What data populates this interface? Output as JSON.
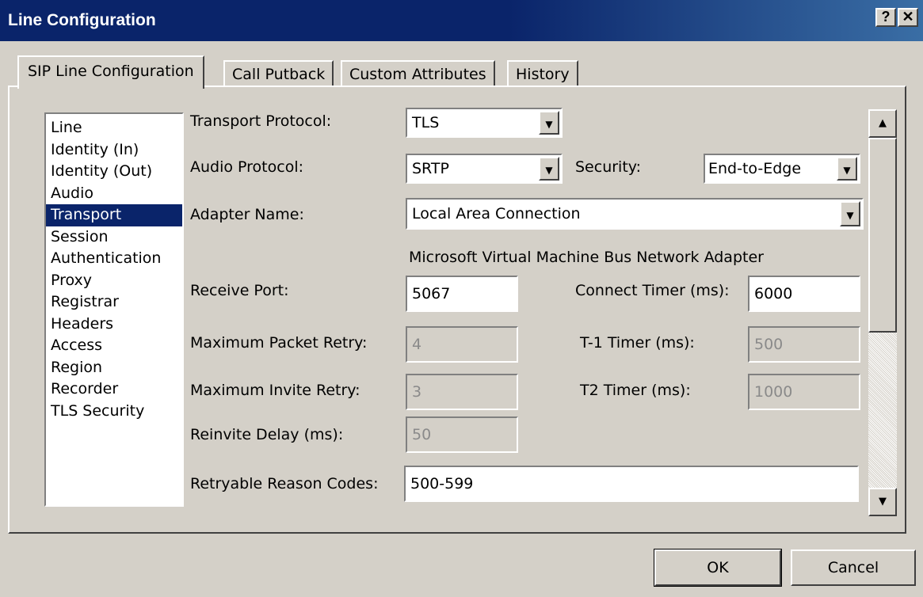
{
  "window": {
    "title": "Line Configuration",
    "help_label": "?",
    "close_label": "✕"
  },
  "tabs": [
    {
      "label": "SIP Line Configuration",
      "active": true
    },
    {
      "label": "Call Putback",
      "active": false
    },
    {
      "label": "Custom Attributes",
      "active": false
    },
    {
      "label": "History",
      "active": false
    }
  ],
  "nav_list": {
    "items": [
      "Line",
      "Identity (In)",
      "Identity (Out)",
      "Audio",
      "Transport",
      "Session",
      "Authentication",
      "Proxy",
      "Registrar",
      "Headers",
      "Access",
      "Region",
      "Recorder",
      "TLS Security"
    ],
    "selected": "Transport"
  },
  "form": {
    "transport_protocol": {
      "label": "Transport Protocol:",
      "value": "TLS"
    },
    "audio_protocol": {
      "label": "Audio Protocol:",
      "value": "SRTP"
    },
    "security": {
      "label": "Security:",
      "value": "End-to-Edge"
    },
    "adapter_name": {
      "label": "Adapter Name:",
      "value": "Local Area Connection",
      "description": "Microsoft Virtual Machine Bus Network Adapter"
    },
    "receive_port": {
      "label": "Receive Port:",
      "value": "5067"
    },
    "connect_timer": {
      "label": "Connect Timer (ms):",
      "value": "6000"
    },
    "max_packet_retry": {
      "label": "Maximum Packet Retry:",
      "value": "4"
    },
    "t1_timer": {
      "label": "T-1 Timer (ms):",
      "value": "500"
    },
    "max_invite_retry": {
      "label": "Maximum Invite Retry:",
      "value": "3"
    },
    "t2_timer": {
      "label": "T2 Timer (ms):",
      "value": "1000"
    },
    "reinvite_delay": {
      "label": "Reinvite Delay (ms):",
      "value": "50"
    },
    "retryable_reason_codes": {
      "label": "Retryable Reason Codes:",
      "value": "500-599"
    }
  },
  "scrollbar": {
    "up_icon": "▲",
    "down_icon": "▼"
  },
  "buttons": {
    "ok": "OK",
    "cancel": "Cancel"
  },
  "colors": {
    "title_bar": "#0a246a",
    "selection": "#0a246a",
    "face": "#d4d0c8"
  }
}
